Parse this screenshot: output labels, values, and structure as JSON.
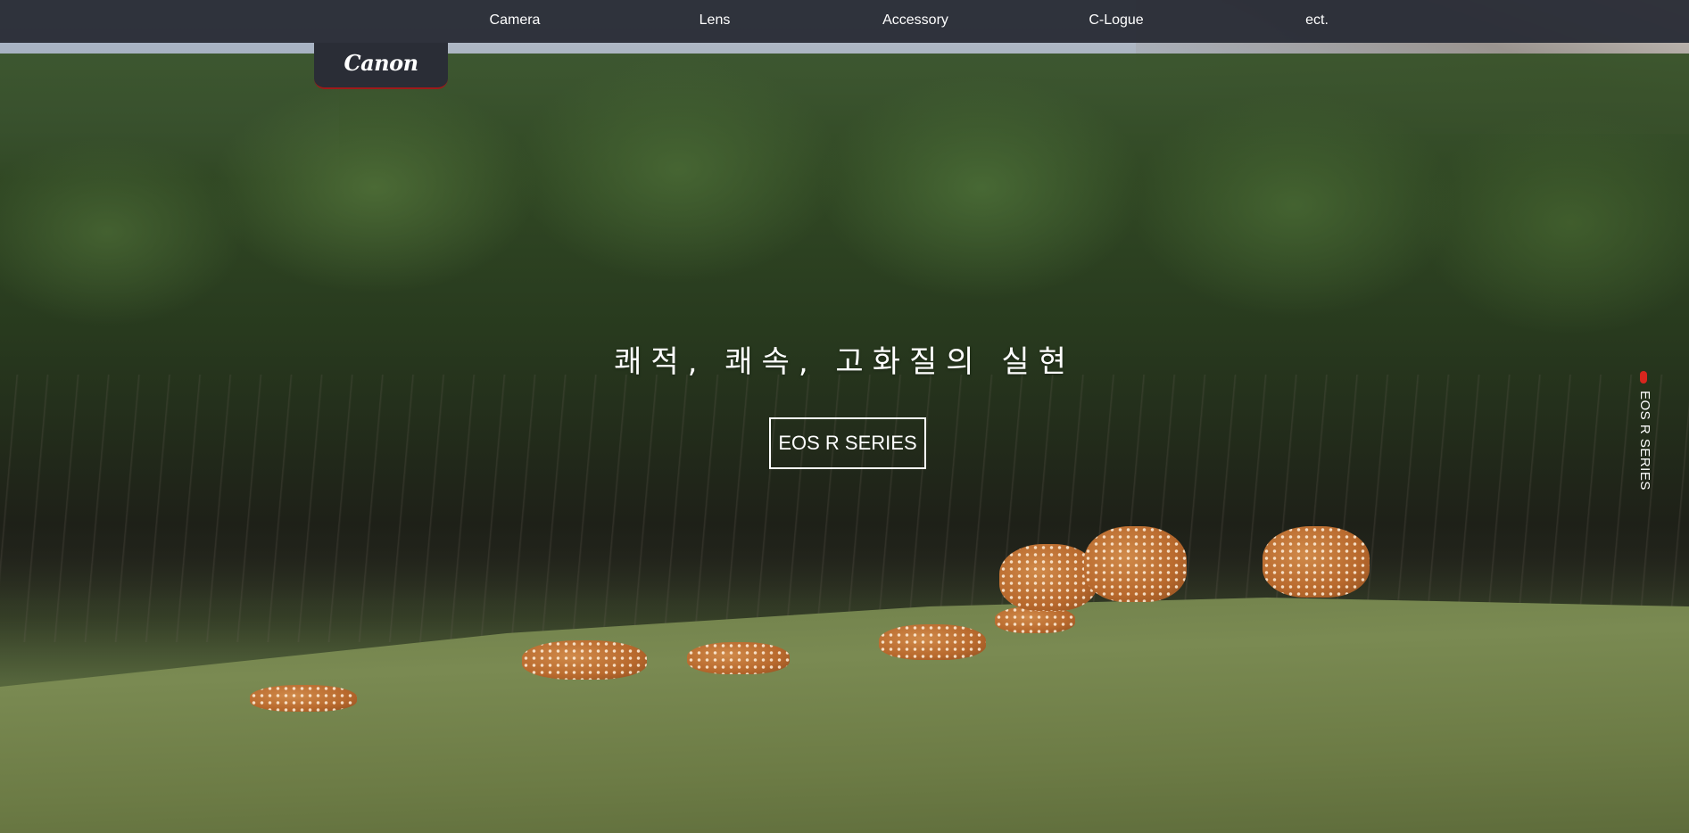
{
  "nav": {
    "items": [
      {
        "label": "Camera"
      },
      {
        "label": "Lens"
      },
      {
        "label": "Accessory"
      },
      {
        "label": "C-Logue"
      },
      {
        "label": "ect."
      }
    ]
  },
  "logo": {
    "text": "Canon",
    "accent_color": "#9e1a1a"
  },
  "hero": {
    "headline": "쾌적, 쾌속, 고화질의 실현",
    "cta_label": "EOS R SERIES",
    "background_description_icon": "deer-meadow-photo"
  },
  "side_indicator": {
    "label": "EOS R SERIES",
    "dot_color": "#d7261e"
  },
  "colors": {
    "topbar": "#2a2d36",
    "text": "#ffffff"
  }
}
